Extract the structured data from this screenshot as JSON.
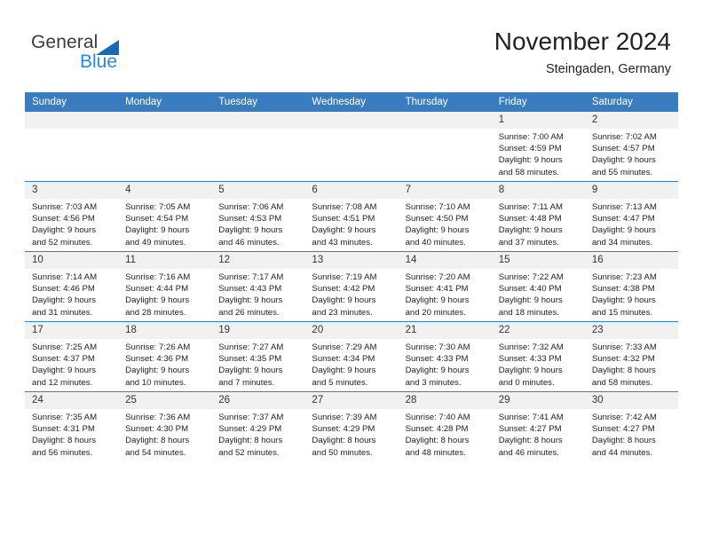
{
  "brand": {
    "name_part1": "General",
    "name_part2": "Blue",
    "accent_color": "#1f8fe0",
    "triangle_color": "#1869b6"
  },
  "header": {
    "month_title": "November 2024",
    "location": "Steingaden, Germany"
  },
  "calendar": {
    "header_color": "#3a7cc0",
    "daynum_band_color": "#f1f1f1",
    "weekday_headers": [
      "Sunday",
      "Monday",
      "Tuesday",
      "Wednesday",
      "Thursday",
      "Friday",
      "Saturday"
    ],
    "weeks": [
      [
        {
          "empty": true
        },
        {
          "empty": true
        },
        {
          "empty": true
        },
        {
          "empty": true
        },
        {
          "empty": true
        },
        {
          "day": "1",
          "sunrise": "Sunrise: 7:00 AM",
          "sunset": "Sunset: 4:59 PM",
          "daylight_line1": "Daylight: 9 hours",
          "daylight_line2": "and 58 minutes."
        },
        {
          "day": "2",
          "sunrise": "Sunrise: 7:02 AM",
          "sunset": "Sunset: 4:57 PM",
          "daylight_line1": "Daylight: 9 hours",
          "daylight_line2": "and 55 minutes."
        }
      ],
      [
        {
          "day": "3",
          "sunrise": "Sunrise: 7:03 AM",
          "sunset": "Sunset: 4:56 PM",
          "daylight_line1": "Daylight: 9 hours",
          "daylight_line2": "and 52 minutes."
        },
        {
          "day": "4",
          "sunrise": "Sunrise: 7:05 AM",
          "sunset": "Sunset: 4:54 PM",
          "daylight_line1": "Daylight: 9 hours",
          "daylight_line2": "and 49 minutes."
        },
        {
          "day": "5",
          "sunrise": "Sunrise: 7:06 AM",
          "sunset": "Sunset: 4:53 PM",
          "daylight_line1": "Daylight: 9 hours",
          "daylight_line2": "and 46 minutes."
        },
        {
          "day": "6",
          "sunrise": "Sunrise: 7:08 AM",
          "sunset": "Sunset: 4:51 PM",
          "daylight_line1": "Daylight: 9 hours",
          "daylight_line2": "and 43 minutes."
        },
        {
          "day": "7",
          "sunrise": "Sunrise: 7:10 AM",
          "sunset": "Sunset: 4:50 PM",
          "daylight_line1": "Daylight: 9 hours",
          "daylight_line2": "and 40 minutes."
        },
        {
          "day": "8",
          "sunrise": "Sunrise: 7:11 AM",
          "sunset": "Sunset: 4:48 PM",
          "daylight_line1": "Daylight: 9 hours",
          "daylight_line2": "and 37 minutes."
        },
        {
          "day": "9",
          "sunrise": "Sunrise: 7:13 AM",
          "sunset": "Sunset: 4:47 PM",
          "daylight_line1": "Daylight: 9 hours",
          "daylight_line2": "and 34 minutes."
        }
      ],
      [
        {
          "day": "10",
          "sunrise": "Sunrise: 7:14 AM",
          "sunset": "Sunset: 4:46 PM",
          "daylight_line1": "Daylight: 9 hours",
          "daylight_line2": "and 31 minutes."
        },
        {
          "day": "11",
          "sunrise": "Sunrise: 7:16 AM",
          "sunset": "Sunset: 4:44 PM",
          "daylight_line1": "Daylight: 9 hours",
          "daylight_line2": "and 28 minutes."
        },
        {
          "day": "12",
          "sunrise": "Sunrise: 7:17 AM",
          "sunset": "Sunset: 4:43 PM",
          "daylight_line1": "Daylight: 9 hours",
          "daylight_line2": "and 26 minutes."
        },
        {
          "day": "13",
          "sunrise": "Sunrise: 7:19 AM",
          "sunset": "Sunset: 4:42 PM",
          "daylight_line1": "Daylight: 9 hours",
          "daylight_line2": "and 23 minutes."
        },
        {
          "day": "14",
          "sunrise": "Sunrise: 7:20 AM",
          "sunset": "Sunset: 4:41 PM",
          "daylight_line1": "Daylight: 9 hours",
          "daylight_line2": "and 20 minutes."
        },
        {
          "day": "15",
          "sunrise": "Sunrise: 7:22 AM",
          "sunset": "Sunset: 4:40 PM",
          "daylight_line1": "Daylight: 9 hours",
          "daylight_line2": "and 18 minutes."
        },
        {
          "day": "16",
          "sunrise": "Sunrise: 7:23 AM",
          "sunset": "Sunset: 4:38 PM",
          "daylight_line1": "Daylight: 9 hours",
          "daylight_line2": "and 15 minutes."
        }
      ],
      [
        {
          "day": "17",
          "sunrise": "Sunrise: 7:25 AM",
          "sunset": "Sunset: 4:37 PM",
          "daylight_line1": "Daylight: 9 hours",
          "daylight_line2": "and 12 minutes."
        },
        {
          "day": "18",
          "sunrise": "Sunrise: 7:26 AM",
          "sunset": "Sunset: 4:36 PM",
          "daylight_line1": "Daylight: 9 hours",
          "daylight_line2": "and 10 minutes."
        },
        {
          "day": "19",
          "sunrise": "Sunrise: 7:27 AM",
          "sunset": "Sunset: 4:35 PM",
          "daylight_line1": "Daylight: 9 hours",
          "daylight_line2": "and 7 minutes."
        },
        {
          "day": "20",
          "sunrise": "Sunrise: 7:29 AM",
          "sunset": "Sunset: 4:34 PM",
          "daylight_line1": "Daylight: 9 hours",
          "daylight_line2": "and 5 minutes."
        },
        {
          "day": "21",
          "sunrise": "Sunrise: 7:30 AM",
          "sunset": "Sunset: 4:33 PM",
          "daylight_line1": "Daylight: 9 hours",
          "daylight_line2": "and 3 minutes."
        },
        {
          "day": "22",
          "sunrise": "Sunrise: 7:32 AM",
          "sunset": "Sunset: 4:33 PM",
          "daylight_line1": "Daylight: 9 hours",
          "daylight_line2": "and 0 minutes."
        },
        {
          "day": "23",
          "sunrise": "Sunrise: 7:33 AM",
          "sunset": "Sunset: 4:32 PM",
          "daylight_line1": "Daylight: 8 hours",
          "daylight_line2": "and 58 minutes."
        }
      ],
      [
        {
          "day": "24",
          "sunrise": "Sunrise: 7:35 AM",
          "sunset": "Sunset: 4:31 PM",
          "daylight_line1": "Daylight: 8 hours",
          "daylight_line2": "and 56 minutes."
        },
        {
          "day": "25",
          "sunrise": "Sunrise: 7:36 AM",
          "sunset": "Sunset: 4:30 PM",
          "daylight_line1": "Daylight: 8 hours",
          "daylight_line2": "and 54 minutes."
        },
        {
          "day": "26",
          "sunrise": "Sunrise: 7:37 AM",
          "sunset": "Sunset: 4:29 PM",
          "daylight_line1": "Daylight: 8 hours",
          "daylight_line2": "and 52 minutes."
        },
        {
          "day": "27",
          "sunrise": "Sunrise: 7:39 AM",
          "sunset": "Sunset: 4:29 PM",
          "daylight_line1": "Daylight: 8 hours",
          "daylight_line2": "and 50 minutes."
        },
        {
          "day": "28",
          "sunrise": "Sunrise: 7:40 AM",
          "sunset": "Sunset: 4:28 PM",
          "daylight_line1": "Daylight: 8 hours",
          "daylight_line2": "and 48 minutes."
        },
        {
          "day": "29",
          "sunrise": "Sunrise: 7:41 AM",
          "sunset": "Sunset: 4:27 PM",
          "daylight_line1": "Daylight: 8 hours",
          "daylight_line2": "and 46 minutes."
        },
        {
          "day": "30",
          "sunrise": "Sunrise: 7:42 AM",
          "sunset": "Sunset: 4:27 PM",
          "daylight_line1": "Daylight: 8 hours",
          "daylight_line2": "and 44 minutes."
        }
      ]
    ]
  }
}
